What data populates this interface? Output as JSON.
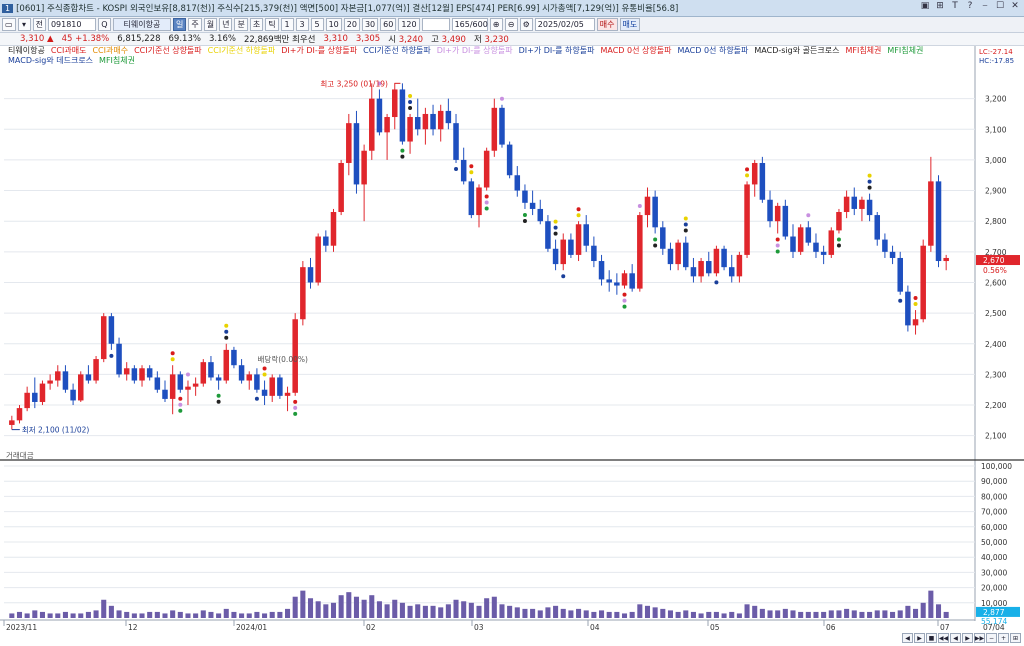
{
  "window": {
    "num": "1",
    "title": "[0601] 주식종합차트 - KOSPI 외국인보유[8,817(천)] 주식수[215,379(천)] 액면[500] 자본금[1,077(억)] 결산[12월] EPS[474] PER[6.99] 시가총액[7,129(억)] 유통비율[56.8]",
    "buttons": [
      "▣",
      "⊞",
      "T",
      "?",
      "⎯",
      "☐",
      "✕"
    ]
  },
  "toolbar": {
    "items": [
      "▭",
      "▾",
      "전",
      "",
      "Q",
      "⊞",
      "▾",
      "",
      "Q",
      "⊞",
      "▾",
      "주",
      "월",
      "년",
      "분",
      "초",
      "틱",
      "1",
      "3",
      "5",
      "10",
      "20",
      "30",
      "60",
      "120",
      "",
      "",
      "",
      "",
      "⊕",
      "⊖",
      "⚙",
      "",
      "▾"
    ],
    "code": "091810",
    "name": "티웨이항공",
    "period_buttons": [
      "일",
      "주",
      "월",
      "년",
      "분",
      "초",
      "틱"
    ],
    "minute_buttons": [
      "1",
      "3",
      "5",
      "10",
      "20",
      "30",
      "60",
      "120"
    ],
    "count": "165/600",
    "date": "2025/02/05",
    "buy_label": "매수",
    "sell_label": "매도"
  },
  "quote": {
    "price": "3,310",
    "arrow": "▲",
    "change": "45",
    "change_pct": "+1.38%",
    "volume": "6,815,228",
    "pct1": "69.13%",
    "pct2": "3.16%",
    "trade_value": "22,869백만",
    "label_prev": "최우선",
    "bid": "3,310",
    "ask": "3,305",
    "open_label": "시",
    "open": "3,240",
    "high_label": "고",
    "high": "3,490",
    "low_label": "저",
    "low": "3,230"
  },
  "legend": [
    {
      "text": "티웨이항공",
      "color": "#222222"
    },
    {
      "text": "CCI과매도",
      "color": "#d81b1b"
    },
    {
      "text": "CCI과매수",
      "color": "#e08a00"
    },
    {
      "text": "CCI기준선 상향돌파",
      "color": "#d81b1b"
    },
    {
      "text": "CCI기준선 하향돌파",
      "color": "#e8d200"
    },
    {
      "text": "DI+가 DI-를 상향돌파",
      "color": "#d81b1b"
    },
    {
      "text": "CCI기준선 하향돌파",
      "color": "#1a3f9a"
    },
    {
      "text": "DI+가 DI-를 상향돌파",
      "color": "#c890e0"
    },
    {
      "text": "DI+가 DI-를 하향돌파",
      "color": "#1a3f9a"
    },
    {
      "text": "MACD 0선 상향돌파",
      "color": "#d81b1b"
    },
    {
      "text": "MACD 0선 하향돌파",
      "color": "#1a3f9a"
    },
    {
      "text": "MACD-sig와 골든크로스",
      "color": "#222222"
    },
    {
      "text": "MFI침체권",
      "color": "#d81b1b"
    },
    {
      "text": "MFI침체권",
      "color": "#1e9a3a"
    },
    {
      "text": "MACD-sig와 데드크로스",
      "color": "#1a3f9a"
    },
    {
      "text": "MFI침체권",
      "color": "#1e9a3a"
    }
  ],
  "right_info": {
    "lc": "LC:-27.14",
    "hc": "HC:-17.85"
  },
  "annotations": {
    "high": "최고 3,250 (01/19)",
    "low": "최저 2,100 (11/02)",
    "dividend": "배당락(0.00%)"
  },
  "price_axis": {
    "labels": [
      "3,200",
      "3,100",
      "3,000",
      "2,900",
      "2,800",
      "2,700",
      "2,600",
      "2,500",
      "2,400",
      "2,300",
      "2,200",
      "2,100"
    ],
    "current_price": "2,670",
    "current_pct": "0.56%"
  },
  "volume_pane": {
    "title": "거래대금",
    "axis_labels": [
      "100,000",
      "90,000",
      "80,000",
      "70,000",
      "60,000",
      "50,000",
      "40,000",
      "30,000",
      "20,000",
      "10,000"
    ],
    "current": "2,877",
    "current2": "55,174"
  },
  "date_axis": {
    "labels": [
      "2023/11",
      "12",
      "2024/01",
      "02",
      "03",
      "04",
      "05",
      "06",
      "07"
    ],
    "right_label": "07/04"
  },
  "nav_buttons": [
    "◀",
    "▶",
    "■",
    "◀◀",
    "◀",
    "▶",
    "▶▶",
    "−",
    "+",
    "⊞"
  ],
  "colors": {
    "up": "#e0262c",
    "down": "#1e4fbf",
    "grid": "#e4e8ee",
    "vol": "#6b5ca8"
  },
  "chart_data": {
    "type": "candlestick",
    "ylim": [
      2050,
      3300
    ],
    "candles": [
      [
        2135,
        2165,
        2120,
        2150
      ],
      [
        2150,
        2200,
        2140,
        2190
      ],
      [
        2190,
        2260,
        2180,
        2240
      ],
      [
        2240,
        2290,
        2190,
        2210
      ],
      [
        2210,
        2280,
        2200,
        2270
      ],
      [
        2270,
        2300,
        2250,
        2280
      ],
      [
        2280,
        2330,
        2260,
        2310
      ],
      [
        2310,
        2330,
        2240,
        2250
      ],
      [
        2250,
        2270,
        2200,
        2215
      ],
      [
        2215,
        2310,
        2210,
        2300
      ],
      [
        2300,
        2330,
        2270,
        2280
      ],
      [
        2280,
        2360,
        2270,
        2350
      ],
      [
        2350,
        2500,
        2340,
        2490
      ],
      [
        2490,
        2500,
        2380,
        2400
      ],
      [
        2400,
        2420,
        2290,
        2300
      ],
      [
        2300,
        2340,
        2280,
        2320
      ],
      [
        2320,
        2330,
        2270,
        2280
      ],
      [
        2280,
        2330,
        2260,
        2320
      ],
      [
        2320,
        2330,
        2280,
        2290
      ],
      [
        2290,
        2310,
        2240,
        2250
      ],
      [
        2250,
        2280,
        2210,
        2220
      ],
      [
        2220,
        2330,
        2170,
        2300
      ],
      [
        2300,
        2310,
        2240,
        2250
      ],
      [
        2250,
        2280,
        2200,
        2260
      ],
      [
        2260,
        2290,
        2230,
        2270
      ],
      [
        2270,
        2350,
        2260,
        2340
      ],
      [
        2340,
        2360,
        2280,
        2290
      ],
      [
        2290,
        2300,
        2250,
        2280
      ],
      [
        2280,
        2400,
        2270,
        2380
      ],
      [
        2380,
        2390,
        2320,
        2330
      ],
      [
        2330,
        2350,
        2270,
        2280
      ],
      [
        2280,
        2310,
        2250,
        2300
      ],
      [
        2300,
        2320,
        2240,
        2250
      ],
      [
        2250,
        2280,
        2200,
        2230
      ],
      [
        2230,
        2300,
        2210,
        2290
      ],
      [
        2290,
        2300,
        2220,
        2230
      ],
      [
        2230,
        2260,
        2180,
        2240
      ],
      [
        2240,
        2500,
        2230,
        2480
      ],
      [
        2480,
        2670,
        2460,
        2650
      ],
      [
        2650,
        2680,
        2580,
        2600
      ],
      [
        2600,
        2760,
        2590,
        2750
      ],
      [
        2750,
        2770,
        2700,
        2720
      ],
      [
        2720,
        2840,
        2700,
        2830
      ],
      [
        2830,
        3000,
        2820,
        2990
      ],
      [
        2990,
        3150,
        2950,
        3120
      ],
      [
        3120,
        3160,
        2890,
        2920
      ],
      [
        2920,
        3050,
        2800,
        3030
      ],
      [
        3030,
        3250,
        3000,
        3200
      ],
      [
        3200,
        3230,
        3080,
        3090
      ],
      [
        3090,
        3150,
        3000,
        3140
      ],
      [
        3140,
        3250,
        3100,
        3230
      ],
      [
        3230,
        3250,
        3050,
        3060
      ],
      [
        3060,
        3150,
        3020,
        3140
      ],
      [
        3140,
        3200,
        3080,
        3100
      ],
      [
        3100,
        3170,
        3050,
        3150
      ],
      [
        3150,
        3180,
        3080,
        3100
      ],
      [
        3100,
        3180,
        3060,
        3160
      ],
      [
        3160,
        3200,
        3100,
        3120
      ],
      [
        3120,
        3150,
        2990,
        3000
      ],
      [
        3000,
        3040,
        2920,
        2930
      ],
      [
        2930,
        2940,
        2810,
        2820
      ],
      [
        2820,
        2920,
        2780,
        2910
      ],
      [
        2910,
        3040,
        2900,
        3030
      ],
      [
        3030,
        3200,
        3010,
        3170
      ],
      [
        3170,
        3180,
        3040,
        3050
      ],
      [
        3050,
        3060,
        2940,
        2950
      ],
      [
        2950,
        2980,
        2880,
        2900
      ],
      [
        2900,
        2920,
        2840,
        2860
      ],
      [
        2860,
        2900,
        2820,
        2840
      ],
      [
        2840,
        2870,
        2790,
        2800
      ],
      [
        2800,
        2820,
        2700,
        2710
      ],
      [
        2710,
        2740,
        2640,
        2660
      ],
      [
        2660,
        2760,
        2640,
        2740
      ],
      [
        2740,
        2760,
        2680,
        2690
      ],
      [
        2690,
        2800,
        2670,
        2790
      ],
      [
        2790,
        2820,
        2700,
        2720
      ],
      [
        2720,
        2750,
        2650,
        2670
      ],
      [
        2670,
        2690,
        2590,
        2610
      ],
      [
        2610,
        2640,
        2570,
        2600
      ],
      [
        2600,
        2630,
        2560,
        2590
      ],
      [
        2590,
        2640,
        2580,
        2630
      ],
      [
        2630,
        2660,
        2570,
        2580
      ],
      [
        2580,
        2830,
        2570,
        2820
      ],
      [
        2820,
        2910,
        2780,
        2880
      ],
      [
        2880,
        2900,
        2760,
        2780
      ],
      [
        2780,
        2800,
        2690,
        2710
      ],
      [
        2710,
        2730,
        2640,
        2660
      ],
      [
        2660,
        2740,
        2640,
        2730
      ],
      [
        2730,
        2750,
        2640,
        2650
      ],
      [
        2650,
        2680,
        2600,
        2620
      ],
      [
        2620,
        2680,
        2600,
        2670
      ],
      [
        2670,
        2700,
        2620,
        2630
      ],
      [
        2630,
        2720,
        2620,
        2710
      ],
      [
        2710,
        2720,
        2640,
        2650
      ],
      [
        2650,
        2690,
        2600,
        2620
      ],
      [
        2620,
        2700,
        2600,
        2690
      ],
      [
        2690,
        2930,
        2680,
        2920
      ],
      [
        2920,
        3000,
        2880,
        2990
      ],
      [
        2990,
        3010,
        2860,
        2870
      ],
      [
        2870,
        2900,
        2780,
        2800
      ],
      [
        2800,
        2860,
        2760,
        2850
      ],
      [
        2850,
        2870,
        2740,
        2750
      ],
      [
        2750,
        2790,
        2680,
        2700
      ],
      [
        2700,
        2790,
        2690,
        2780
      ],
      [
        2780,
        2800,
        2720,
        2730
      ],
      [
        2730,
        2760,
        2680,
        2700
      ],
      [
        2700,
        2720,
        2660,
        2690
      ],
      [
        2690,
        2780,
        2680,
        2770
      ],
      [
        2770,
        2840,
        2760,
        2830
      ],
      [
        2830,
        2900,
        2810,
        2880
      ],
      [
        2880,
        2910,
        2820,
        2840
      ],
      [
        2840,
        2880,
        2800,
        2870
      ],
      [
        2870,
        2890,
        2800,
        2820
      ],
      [
        2820,
        2830,
        2720,
        2740
      ],
      [
        2740,
        2760,
        2680,
        2700
      ],
      [
        2700,
        2720,
        2660,
        2680
      ],
      [
        2680,
        2700,
        2560,
        2570
      ],
      [
        2570,
        2590,
        2440,
        2460
      ],
      [
        2460,
        2510,
        2430,
        2480
      ],
      [
        2480,
        2740,
        2470,
        2720
      ],
      [
        2720,
        3010,
        2700,
        2930
      ],
      [
        2930,
        2950,
        2650,
        2670
      ],
      [
        2670,
        2690,
        2640,
        2680
      ]
    ],
    "volume": [
      3,
      4,
      3,
      5,
      4,
      3,
      3,
      4,
      3,
      3,
      4,
      5,
      12,
      8,
      5,
      4,
      3,
      3,
      4,
      4,
      3,
      5,
      4,
      3,
      3,
      5,
      4,
      3,
      6,
      4,
      3,
      3,
      4,
      3,
      4,
      4,
      6,
      14,
      18,
      13,
      11,
      9,
      10,
      15,
      17,
      14,
      12,
      15,
      11,
      9,
      12,
      10,
      8,
      9,
      8,
      8,
      7,
      9,
      12,
      11,
      10,
      8,
      13,
      14,
      9,
      8,
      7,
      6,
      6,
      5,
      7,
      8,
      6,
      5,
      6,
      5,
      4,
      5,
      4,
      4,
      3,
      4,
      9,
      8,
      7,
      6,
      5,
      4,
      5,
      4,
      3,
      4,
      4,
      3,
      4,
      3,
      9,
      8,
      6,
      5,
      5,
      6,
      5,
      4,
      4,
      4,
      4,
      5,
      5,
      6,
      5,
      4,
      4,
      5,
      5,
      4,
      5,
      8,
      6,
      10,
      18,
      9,
      4
    ]
  }
}
